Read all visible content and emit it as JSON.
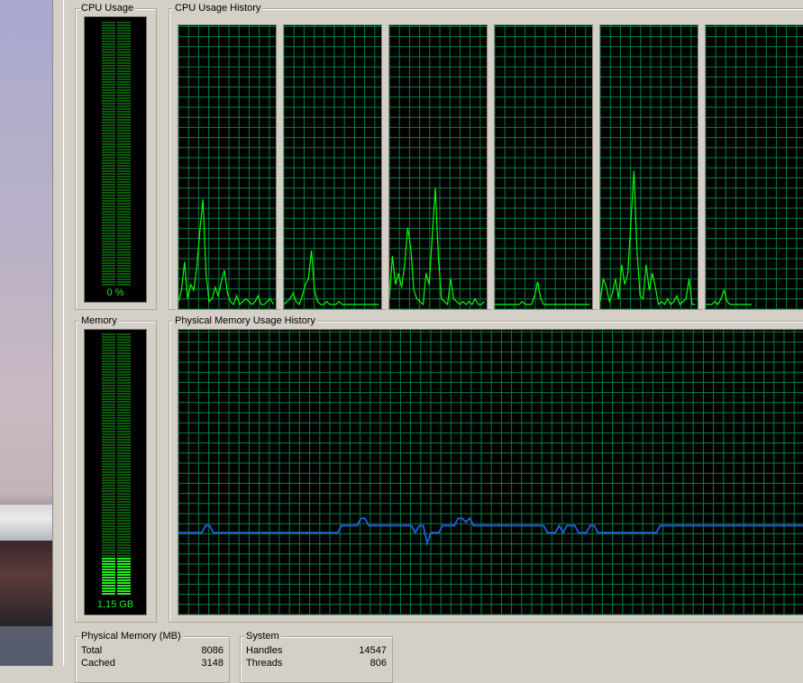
{
  "cpu_usage": {
    "title": "CPU Usage",
    "value_text": "0 %"
  },
  "cpu_history": {
    "title": "CPU Usage History",
    "cores": [
      {
        "series": [
          2,
          6,
          16,
          3,
          8,
          6,
          14,
          27,
          38,
          12,
          2,
          3,
          7,
          4,
          9,
          13,
          5,
          2,
          1,
          4,
          1,
          2,
          3,
          2,
          1,
          2,
          4,
          1,
          1,
          2,
          3,
          1
        ]
      },
      {
        "series": [
          1,
          2,
          3,
          5,
          2,
          1,
          4,
          8,
          10,
          20,
          6,
          2,
          1,
          1,
          2,
          1,
          1,
          1,
          2,
          1,
          1,
          1,
          1,
          1,
          1,
          1,
          1,
          1,
          1,
          1,
          1,
          1
        ]
      },
      {
        "series": [
          3,
          18,
          8,
          12,
          7,
          15,
          28,
          21,
          6,
          3,
          2,
          1,
          12,
          8,
          25,
          42,
          18,
          3,
          2,
          1,
          10,
          3,
          2,
          1,
          2,
          1,
          2,
          1,
          3,
          1,
          1,
          2
        ]
      },
      {
        "series": [
          1,
          1,
          1,
          1,
          1,
          1,
          1,
          1,
          1,
          2,
          1,
          1,
          1,
          4,
          9,
          3,
          1,
          1,
          1,
          1,
          1,
          1,
          1,
          1,
          1,
          1,
          1,
          1,
          1,
          1,
          1,
          1
        ]
      },
      {
        "series": [
          2,
          10,
          7,
          2,
          5,
          10,
          3,
          15,
          8,
          12,
          30,
          48,
          20,
          4,
          3,
          15,
          6,
          12,
          7,
          1,
          2,
          1,
          3,
          1,
          2,
          4,
          1,
          2,
          3,
          10,
          1,
          1
        ]
      },
      {
        "series": [
          1,
          1,
          1,
          2,
          1,
          3,
          6,
          2,
          1,
          1,
          1,
          1,
          1,
          1,
          1,
          1
        ]
      }
    ]
  },
  "memory": {
    "title": "Memory",
    "value_text": "1,15 GB",
    "fraction": 0.14
  },
  "memory_history": {
    "title": "Physical Memory Usage History",
    "series": [
      2.3,
      2.3,
      2.3,
      2.3,
      2.3,
      2.3,
      2.3,
      2.5,
      2.5,
      2.3,
      2.3,
      2.3,
      2.3,
      2.3,
      2.3,
      2.3,
      2.3,
      2.3,
      2.3,
      2.3,
      2.3,
      2.3,
      2.3,
      2.3,
      2.3,
      2.3,
      2.3,
      2.3,
      2.3,
      2.3,
      2.3,
      2.3,
      2.3,
      2.3,
      2.3,
      2.3,
      2.3,
      2.3,
      2.3,
      2.3,
      2.3,
      2.3,
      2.5,
      2.5,
      2.5,
      2.5,
      2.5,
      2.7,
      2.7,
      2.5,
      2.5,
      2.5,
      2.5,
      2.5,
      2.5,
      2.5,
      2.5,
      2.5,
      2.5,
      2.5,
      2.5,
      2.3,
      2.5,
      2.5,
      2.0,
      2.3,
      2.3,
      2.3,
      2.5,
      2.5,
      2.5,
      2.5,
      2.7,
      2.7,
      2.6,
      2.7,
      2.5,
      2.5,
      2.5,
      2.5,
      2.5,
      2.5,
      2.5,
      2.5,
      2.5,
      2.5,
      2.5,
      2.5,
      2.5,
      2.5,
      2.5,
      2.5,
      2.5,
      2.5,
      2.5,
      2.3,
      2.3,
      2.3,
      2.5,
      2.3,
      2.5,
      2.5,
      2.5,
      2.3,
      2.3,
      2.3,
      2.5,
      2.5,
      2.3,
      2.3,
      2.3,
      2.3,
      2.3,
      2.3,
      2.3,
      2.3,
      2.3,
      2.3,
      2.3,
      2.3,
      2.3,
      2.3,
      2.3,
      2.3,
      2.5,
      2.5,
      2.5,
      2.5,
      2.5,
      2.5,
      2.5,
      2.5,
      2.5,
      2.5,
      2.5,
      2.5,
      2.5,
      2.5,
      2.5,
      2.5,
      2.5,
      2.5,
      2.5,
      2.5,
      2.5,
      2.5,
      2.5,
      2.5,
      2.5,
      2.5,
      2.5,
      2.5,
      2.5,
      2.5,
      2.5,
      2.5,
      2.5,
      2.5,
      2.5,
      2.5,
      2.5,
      2.5
    ]
  },
  "physical_memory": {
    "title": "Physical Memory (MB)",
    "rows": [
      {
        "label": "Total",
        "value": "8086"
      },
      {
        "label": "Cached",
        "value": "3148"
      }
    ]
  },
  "system": {
    "title": "System",
    "rows": [
      {
        "label": "Handles",
        "value": "14547"
      },
      {
        "label": "Threads",
        "value": "806"
      }
    ]
  },
  "colors": {
    "grid": "#008040",
    "cpu_line": "#00ff00",
    "memory_line": "#2060e0",
    "meter_on": "#22ee22",
    "meter_off": "#0a5a0a"
  }
}
